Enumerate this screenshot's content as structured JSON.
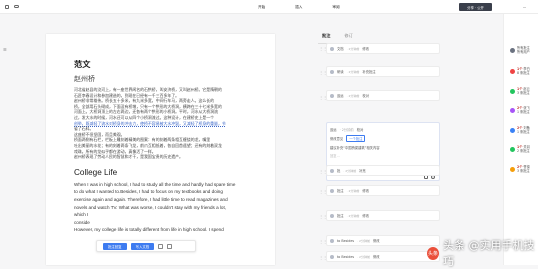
{
  "topbar": {
    "menu": [
      "开始",
      "插入",
      "审阅"
    ],
    "share_label": "分享 · 公开",
    "more": "···"
  },
  "document": {
    "title": "范文",
    "author": "赵州桥",
    "cn_lines": [
      "河北省赵县的洨河上，有一座世界闻名的石拱桥，叫安济桥，又叫赵州桥。它是隋朝的",
      "石匠李春设计和参加建造的，到现在已经有一千三百多年了。",
      "赵州桥非常雄伟。桥长五十多米，有九米多宽，中间行车马，两旁走人。这么长的",
      "桥，全部用石头砌成，下面没有桥墩，只有一个拱形的大桥洞，横跨在三十七米多宽的",
      "河面上。大桥洞顶上的左右两边，还各有两个拱形的小桥洞。平时，河水从大桥洞流",
      "过，发大水的时候，河水还可以从四个小桥洞流过。这种设计，在建桥史上是一个",
      "创举，既减轻了流水对桥身的冲击力，使桥不容易被大水冲毁，又减轻了桥身的重量，节",
      "省了石料。",
      "这座桥不但坚固，而且美观。",
      "桥面两侧有石栏，栏板上雕刻着精美的图案：有的刻着两条相互缠绕的龙，嘴里",
      "吐出美丽的水花；有的刻着两条飞龙，前爪互相抵着，各自回首遥望；还有的刻着双龙",
      "戏珠。所有的龙似乎都在游动，真像活了一样。",
      "赵州桥表现了劳动人民的智慧和才干，是我国宝贵的历史遗产。"
    ],
    "en_title": "College Life",
    "en_lines": [
      "When I was in high school, I had to study all the time and hardly had spare time",
      "to do what I wanted to.Besides, I had to focus on my textbooks and doing",
      "exercise again and again. Therefore, I had little time to read magazines and",
      "novels and watch TV. What was worse, I couldn't stay with my friends a lot,",
      "which I",
      "conside",
      "However, my college life is totally different from life in high school. I spend"
    ]
  },
  "floatbar": {
    "btn1": "批注回复",
    "btn2": "写入文档"
  },
  "sidebar": {
    "tabs": [
      "批注",
      "修订"
    ],
    "comments": [
      {
        "handle": "⋮⋮",
        "author": "文档",
        "time": "· 2分钟前",
        "text": "修改"
      },
      {
        "handle": "⋮⋮",
        "author": "研读",
        "time": "· 2分钟前",
        "text": "补充批注"
      },
      {
        "handle": "⋮⋮",
        "author": "遥远",
        "time": "· 2分钟前",
        "text": "校对"
      },
      {
        "handle": "⋮⋮",
        "author": "批",
        "time": "· 2分钟前",
        "text": "补充"
      },
      {
        "handle": "⋮⋮",
        "author": "批注",
        "time": "· 2分钟前",
        "text": "修改"
      },
      {
        "handle": "⋮⋮",
        "author": "批注",
        "time": "· 2分钟前",
        "text": "修改"
      },
      {
        "handle": "⋮⋮",
        "author": "to Besides",
        "time": "· 2分钟前",
        "text": "修改"
      },
      {
        "handle": "⋮⋮",
        "author": "to Besides",
        "time": "· 2分钟前",
        "text": "修改"
      }
    ],
    "expanded": {
      "row1_author": "遥远",
      "row1_time": "· 2分钟前",
      "row1_text": "校对",
      "row2_a": "修改意见",
      "row2_chip": "一个批注",
      "row3": "建议补充“中国桥梁建筑”相关内容",
      "reply_placeholder": "回复..."
    }
  },
  "users": [
    {
      "name": "所有批注",
      "count": "",
      "sub": "所有用户",
      "color": "#6b7280"
    },
    {
      "name": "1个",
      "count": "李白",
      "sub": "8 条批注",
      "color": "#ef4444"
    },
    {
      "name": "1个",
      "count": "赵云",
      "sub": "3 条批注",
      "color": "#22c55e"
    },
    {
      "name": "2个",
      "count": "张飞",
      "sub": "1 条批注",
      "color": "#a855f7"
    },
    {
      "name": "2个",
      "count": "刘备",
      "sub": "1 条批注",
      "color": "#3b82f6"
    },
    {
      "name": "1个",
      "count": "关羽",
      "sub": "2 条批注",
      "color": "#22c55e"
    },
    {
      "name": "2个",
      "count": "曹操",
      "sub": "3 条批注",
      "color": "#f59e0b"
    }
  ],
  "watermark": {
    "logo": "头条",
    "text": "头条 @实用手机技巧"
  }
}
